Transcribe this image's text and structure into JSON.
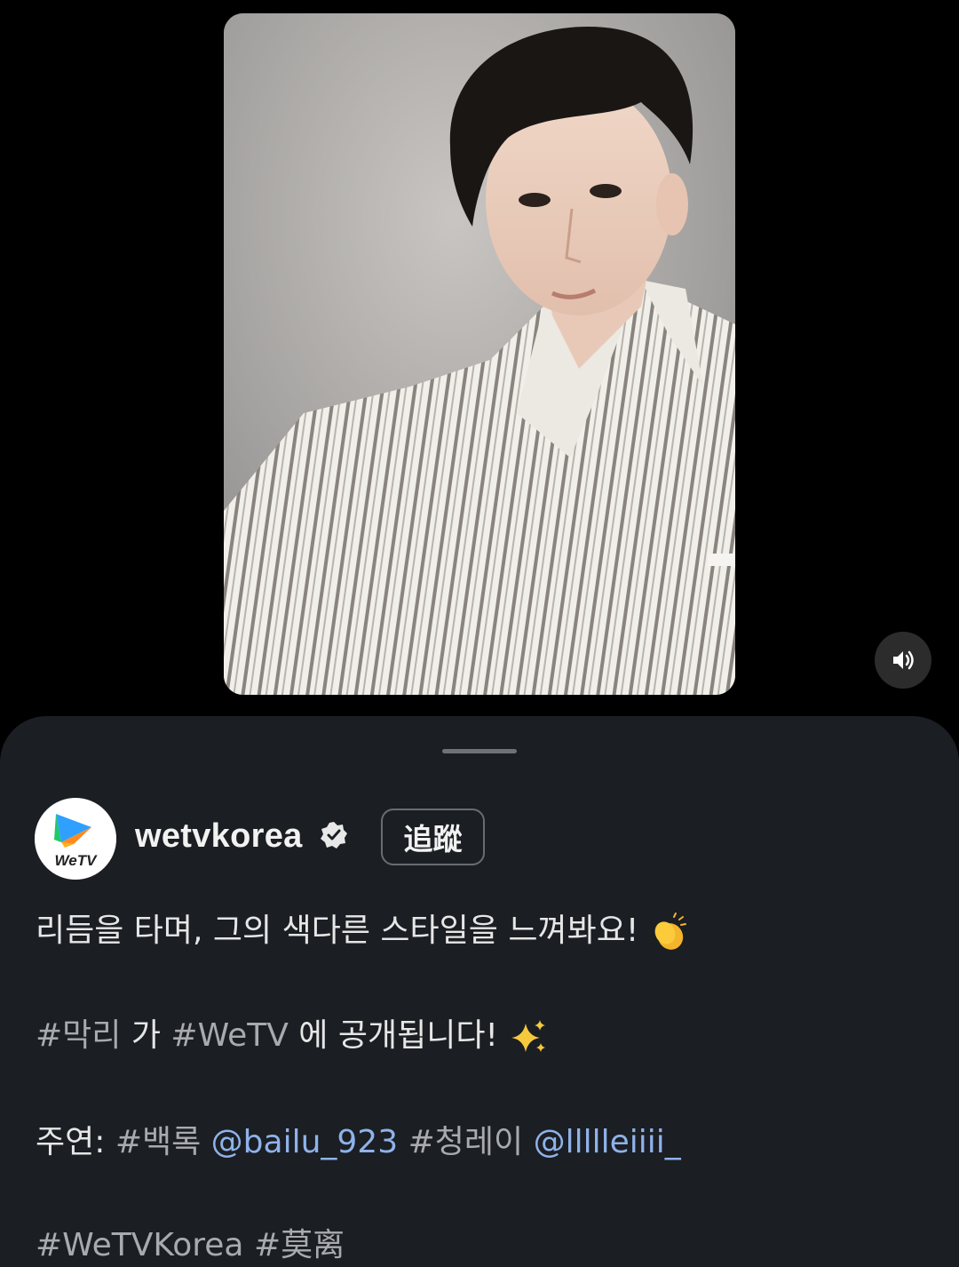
{
  "post": {
    "account": {
      "username": "wetvkorea",
      "avatar_text": "WeTV",
      "verified": true
    },
    "follow_label": "追蹤",
    "caption": {
      "line1": "리듬을 타며, 그의 색다른 스타일을 느껴봐요!",
      "line1_emoji": "clapping-hands-icon",
      "line2_tag1": "#막리",
      "line2_text1": " 가 ",
      "line2_tag2": "#WeTV",
      "line2_text2": " 에 공개됩니다! ",
      "line2_emoji": "sparkles-icon",
      "line3_label": "주연: ",
      "line3_tag1": "#백록",
      "line3_mention1": "@bailu_923",
      "line3_tag2": "#청레이",
      "line3_mention2": "@llllleiiii_",
      "line4_tag1": "#WeTVKorea",
      "line4_tag2": "#莫离"
    }
  },
  "media": {
    "type": "portrait-photo",
    "sound_icon": "speaker-icon"
  },
  "colors": {
    "background": "#000000",
    "sheet": "#1b1e22",
    "text": "#e6e6e6",
    "hashtag": "#a8aaad",
    "mention": "#8fb2ea"
  }
}
